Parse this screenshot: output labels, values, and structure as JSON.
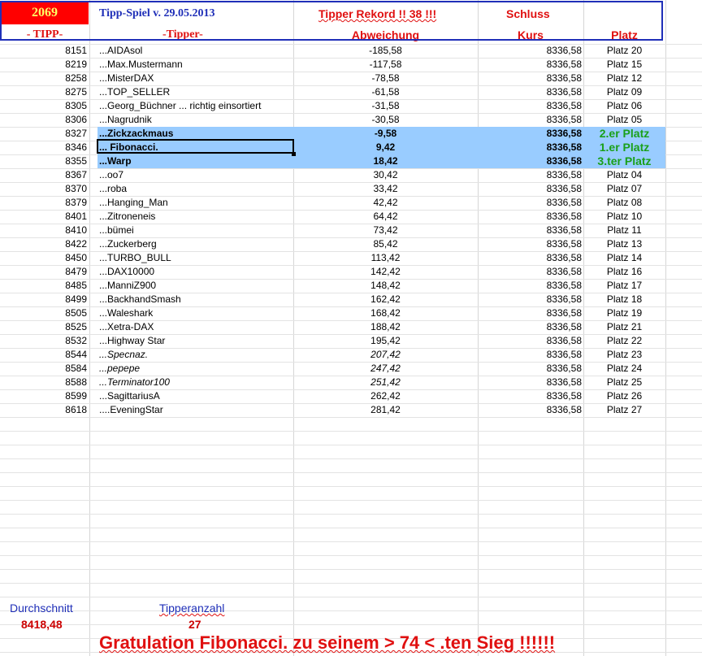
{
  "header": {
    "year": "2069",
    "title": "Tipp-Spiel v. 29.05.2013",
    "record": "Tipper Rekord !!  38  !!!",
    "schluss": "Schluss",
    "col_tipp": "- TIPP-",
    "col_tipper": "-Tipper-",
    "col_abweichung": "Abweichung",
    "col_kurs": "Kurs",
    "col_platz": "Platz"
  },
  "rows": [
    {
      "tipp": "8151",
      "name": "...AIDAsol",
      "dev": "-185,58",
      "kurs": "8336,58",
      "platz": "Platz 20"
    },
    {
      "tipp": "8219",
      "name": "...Max.Mustermann",
      "dev": "-117,58",
      "kurs": "8336,58",
      "platz": "Platz 15"
    },
    {
      "tipp": "8258",
      "name": "...MisterDAX",
      "dev": "-78,58",
      "kurs": "8336,58",
      "platz": "Platz 12"
    },
    {
      "tipp": "8275",
      "name": "...TOP_SELLER",
      "dev": "-61,58",
      "kurs": "8336,58",
      "platz": "Platz 09"
    },
    {
      "tipp": "8305",
      "name": "...Georg_Büchner ... richtig einsortiert",
      "dev": "-31,58",
      "kurs": "8336,58",
      "platz": "Platz 06"
    },
    {
      "tipp": "8306",
      "name": "...Nagrudnik",
      "dev": "-30,58",
      "kurs": "8336,58",
      "platz": "Platz 05"
    },
    {
      "tipp": "8327",
      "name": "...Zickzackmaus",
      "dev": "-9,58",
      "kurs": "8336,58",
      "platz": "2.er Platz",
      "highlight": true
    },
    {
      "tipp": "8346",
      "name": "... Fibonacci.",
      "dev": "9,42",
      "kurs": "8336,58",
      "platz": "1.er Platz",
      "highlight": true
    },
    {
      "tipp": "8355",
      "name": "...Warp",
      "dev": "18,42",
      "kurs": "8336,58",
      "platz": "3.ter Platz",
      "highlight": true
    },
    {
      "tipp": "8367",
      "name": "...oo7",
      "dev": "30,42",
      "kurs": "8336,58",
      "platz": "Platz 04"
    },
    {
      "tipp": "8370",
      "name": "...roba",
      "dev": "33,42",
      "kurs": "8336,58",
      "platz": "Platz 07"
    },
    {
      "tipp": "8379",
      "name": "...Hanging_Man",
      "dev": "42,42",
      "kurs": "8336,58",
      "platz": "Platz 08"
    },
    {
      "tipp": "8401",
      "name": "...Zitroneneis",
      "dev": "64,42",
      "kurs": "8336,58",
      "platz": "Platz 10"
    },
    {
      "tipp": "8410",
      "name": "...bümei",
      "dev": "73,42",
      "kurs": "8336,58",
      "platz": "Platz 11"
    },
    {
      "tipp": "8422",
      "name": "...Zuckerberg",
      "dev": "85,42",
      "kurs": "8336,58",
      "platz": "Platz 13"
    },
    {
      "tipp": "8450",
      "name": "...TURBO_BULL",
      "dev": "113,42",
      "kurs": "8336,58",
      "platz": "Platz 14"
    },
    {
      "tipp": "8479",
      "name": "...DAX10000",
      "dev": "142,42",
      "kurs": "8336,58",
      "platz": "Platz 16"
    },
    {
      "tipp": "8485",
      "name": "...ManniZ900",
      "dev": "148,42",
      "kurs": "8336,58",
      "platz": "Platz 17"
    },
    {
      "tipp": "8499",
      "name": "...BackhandSmash",
      "dev": "162,42",
      "kurs": "8336,58",
      "platz": "Platz 18"
    },
    {
      "tipp": "8505",
      "name": "...Waleshark",
      "dev": "168,42",
      "kurs": "8336,58",
      "platz": "Platz 19"
    },
    {
      "tipp": "8525",
      "name": "...Xetra-DAX",
      "dev": "188,42",
      "kurs": "8336,58",
      "platz": "Platz 21"
    },
    {
      "tipp": "8532",
      "name": "...Highway Star",
      "dev": "195,42",
      "kurs": "8336,58",
      "platz": "Platz 22"
    },
    {
      "tipp": "8544",
      "name": "...Specnaz.",
      "dev": "207,42",
      "kurs": "8336,58",
      "platz": "Platz 23",
      "italic": true
    },
    {
      "tipp": "8584",
      "name": "...pepepe",
      "dev": "247,42",
      "kurs": "8336,58",
      "platz": "Platz 24",
      "italic": true
    },
    {
      "tipp": "8588",
      "name": "...Terminator100",
      "dev": "251,42",
      "kurs": "8336,58",
      "platz": "Platz 25",
      "italic": true
    },
    {
      "tipp": "8599",
      "name": "...SagittariusA",
      "dev": "262,42",
      "kurs": "8336,58",
      "platz": "Platz 26"
    },
    {
      "tipp": "8618",
      "name": "....EveningStar",
      "dev": "281,42",
      "kurs": "8336,58",
      "platz": "Platz 27"
    }
  ],
  "footer": {
    "avg_label": "Durchschnitt",
    "avg_value": "8418,48",
    "count_label": "Tipperanzahl",
    "count_value": "27",
    "congrats": "Gratulation Fibonacci.  zu seinem > 74 < .ten Sieg !!!!!!"
  },
  "colors": {
    "highlight": "#99ccff",
    "header_red": "#e01010",
    "header_blue": "#1f2fb8",
    "podium_green": "#1aa01a",
    "year_bg": "#ff0000",
    "year_text": "#ffff66"
  }
}
